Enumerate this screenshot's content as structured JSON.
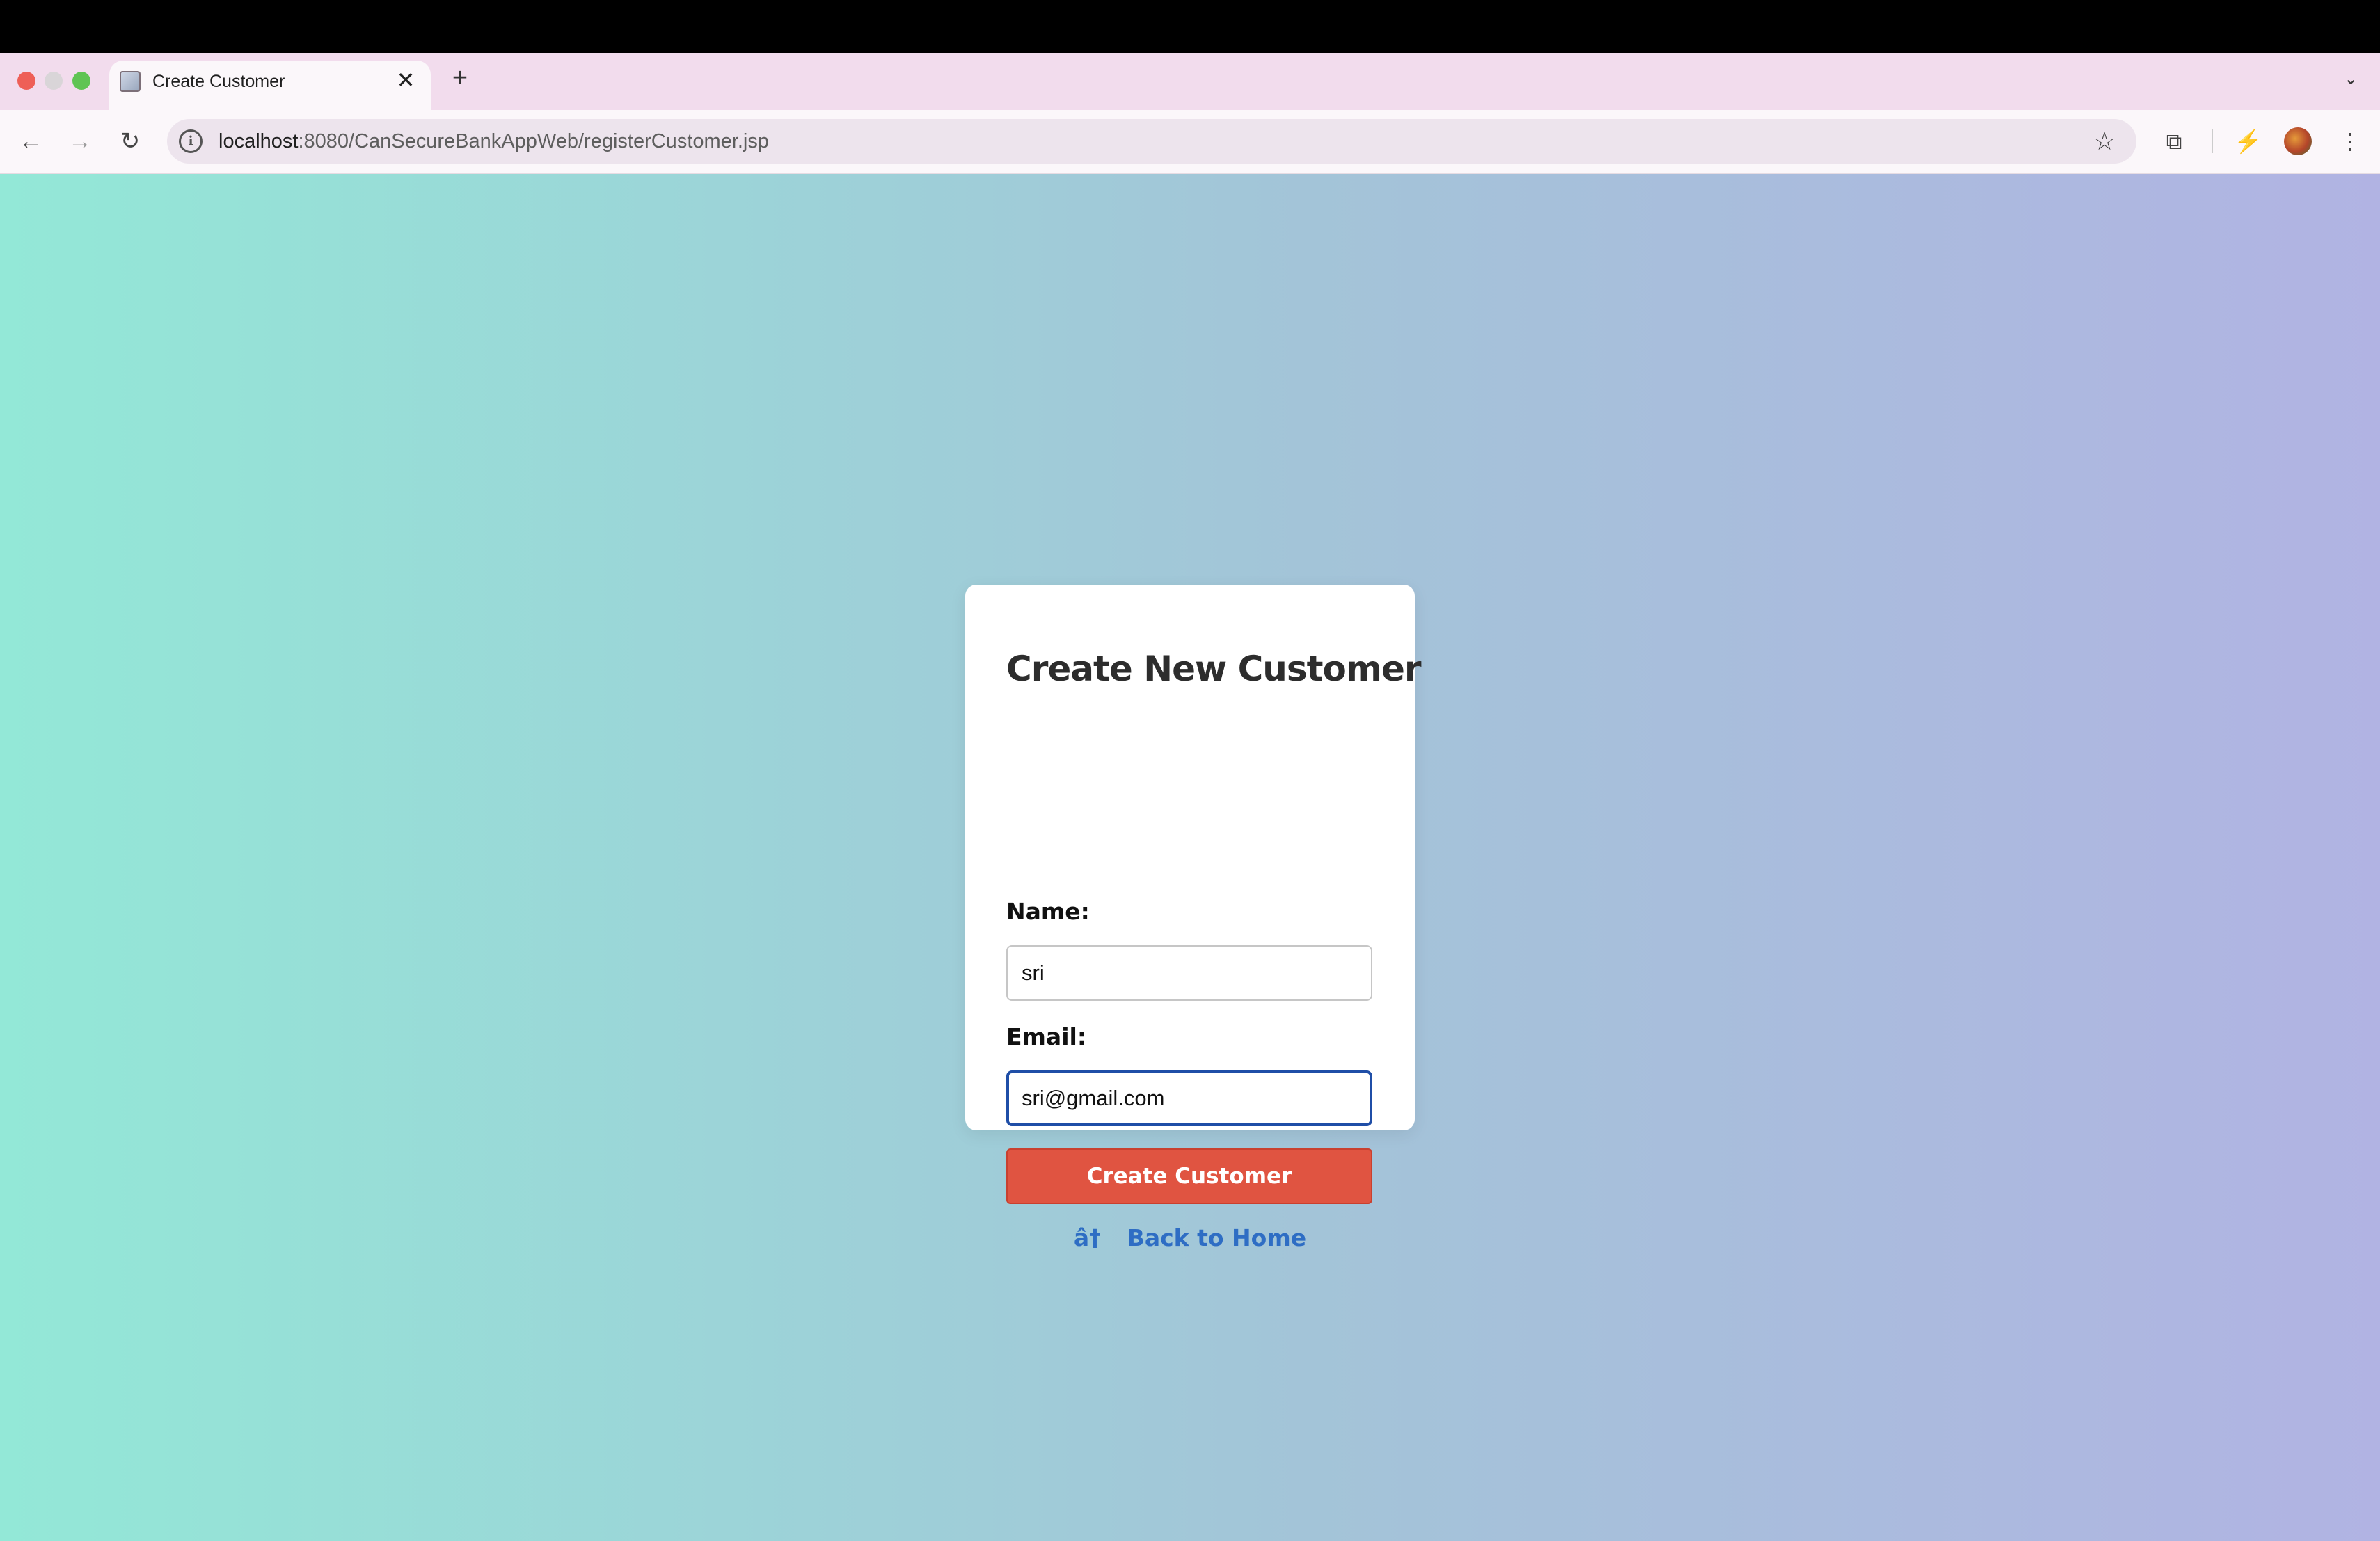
{
  "browser": {
    "tab_title": "Create Customer",
    "tab_close": "✕",
    "new_tab": "+",
    "tab_dropdown": "⌄",
    "url_host": "localhost",
    "url_path": ":8080/CanSecureBankAppWeb/registerCustomer.jsp",
    "site_info_icon": "i",
    "back": "←",
    "forward": "→",
    "reload": "↻",
    "star": "☆",
    "extensions": "⧉",
    "performance": "⚡",
    "menu": "⋮"
  },
  "form": {
    "title": "Create New Customer",
    "name_label": "Name:",
    "name_value": "sri",
    "email_label": "Email:",
    "email_value": "sri@gmail.com",
    "submit_label": "Create Customer",
    "back_arrow": "â†",
    "back_label": "Back to Home"
  },
  "colors": {
    "button": "#e05441",
    "link": "#2e6dc4",
    "focus_border": "#1f4ea7"
  }
}
